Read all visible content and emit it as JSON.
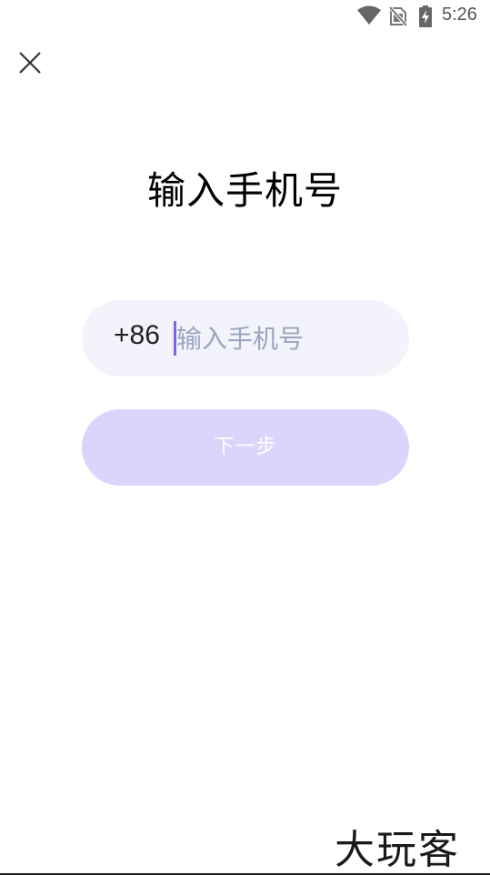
{
  "status_bar": {
    "time": "5:26",
    "icons": [
      "wifi-icon",
      "no-sim-icon",
      "battery-charging-icon"
    ]
  },
  "header": {
    "close_icon": "close-icon"
  },
  "main": {
    "title": "输入手机号",
    "phone": {
      "country_code": "+86",
      "placeholder": "输入手机号",
      "value": ""
    },
    "next_label": "下一步"
  },
  "watermark": "大玩客",
  "colors": {
    "accent": "#7b67e6",
    "button_bg": "#ddd4fc",
    "field_bg": "#f3f3fb",
    "placeholder": "#9aa6bd"
  }
}
